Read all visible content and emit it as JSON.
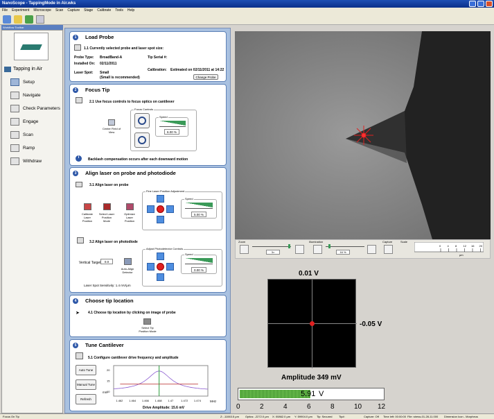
{
  "window": {
    "title": "NanoScope - TappingMode in Air.wks"
  },
  "menu": [
    "File",
    "Experiment",
    "Microscope",
    "Scan",
    "Capture",
    "Stage",
    "Calibrate",
    "Tools",
    "Help"
  ],
  "workflow": {
    "header": "Workflow Toolbar",
    "mode": "Tapping in Air",
    "items": [
      "Setup",
      "Navigate",
      "Check Parameters",
      "Engage",
      "Scan",
      "Ramp",
      "Withdraw"
    ]
  },
  "load_probe": {
    "num": "1",
    "title": "Load Probe",
    "step": "1.1 Currently selected probe and laser spot size:",
    "probe_type_label": "Probe Type:",
    "probe_type": "BroadBand-A",
    "tip_serial_label": "Tip Serial #:",
    "installed_label": "Installed On:",
    "installed": "02/11/2011",
    "calibration_label": "Calibration:",
    "calibration": "Estimated on 02/11/2011 at 14:22",
    "laser_spot_label": "Laser Spot:",
    "laser_spot": "Small",
    "laser_note": "(Small is recommended)",
    "change_button": "Change Probe"
  },
  "focus_tip": {
    "num": "2",
    "title": "Focus Tip",
    "step": "2.1 Use focus controls to focus optics on cantilever",
    "controls_label": "Focus Controls",
    "center_field": "Center Field of View",
    "speed_label": "Speed",
    "speed_value": "6.00 %",
    "backlash": "Backlash compensation occurs after each downward motion"
  },
  "align_laser": {
    "num": "3",
    "title": "Align laser on probe and photodiode",
    "step1": "3.1 Align laser on probe",
    "fine_label": "Fine Laser Position Adjustment",
    "calibrate": "Calibrate Laser Position",
    "select_mode": "Select Laser Position Mode",
    "optimize": "Optimize Laser Position",
    "speed_label": "Speed",
    "speed1": "5.00 %",
    "step2": "3.2 Align laser on photodiode",
    "pd_label": "Adjust Photodetector Controls",
    "vertical_label": "Vertical Target:",
    "vertical_value": "0.0",
    "auto_align": "Auto-Align Detector",
    "speed2": "0.00 %",
    "sensitivity": "Laser Spot Sensitivity: 1.4 mV/μm"
  },
  "tip_location": {
    "num": "4",
    "title": "Choose tip location",
    "step": "4.1 Choose tip location by clicking on image of probe",
    "select_mode": "Select Tip Position Mode"
  },
  "tune": {
    "num": "5",
    "title": "Tune Cantilever",
    "step": "5.1 Configure cantilever drive frequency and amplitude",
    "auto_tune": "Auto Tune",
    "manual_tune": "Manual Tune",
    "refresh": "Refresh",
    "y_unit": "mm",
    "x_unit": "MHz",
    "drive_amp": "Drive Amplitude: 15.6 mV",
    "chart_data": {
      "type": "line",
      "x": [
        1.462,
        1.464,
        1.466,
        1.468,
        1.47,
        1.472,
        1.474
      ],
      "xticks": [
        "1.462",
        "1.464",
        "1.466",
        "1.468",
        "1.47",
        "1.472",
        "1.474"
      ],
      "yticks": [
        "20",
        "15",
        "10"
      ],
      "series": [
        {
          "values": [
            11,
            12.2,
            15,
            19.5,
            15,
            12.2,
            11
          ],
          "color": "#8a5ad0"
        },
        {
          "values": [
            13.5,
            13.5,
            13.5,
            13.5,
            13.5,
            13.5,
            13.5
          ],
          "color": "#c04040"
        }
      ],
      "peak_x": 1.468,
      "xlim": [
        1.461,
        1.4755
      ],
      "ylim": [
        8,
        22
      ]
    }
  },
  "camera_controls": {
    "zoom_label": "Zoom",
    "zoom_value": "3×",
    "illum_label": "Illumination",
    "illum_value": "16 %",
    "capture_label": "Capture",
    "scale_label": "Scale",
    "scale_ticks": [
      "0",
      "4",
      "8",
      "12",
      "16",
      "20"
    ],
    "scale_unit": "μm"
  },
  "detector": {
    "top_value": "0.01 V",
    "side_value": "-0.05 V",
    "amplitude": "Amplitude 349 mV",
    "bar_value": "5.91",
    "bar_unit": "V",
    "bar_fraction": 0.4925,
    "scale": [
      "0",
      "2",
      "4",
      "6",
      "8",
      "10",
      "12"
    ]
  },
  "status": {
    "left": "Focus On Tip",
    "z": "Z: -11063.5 μm",
    "optics": "Optics: -2272.0 μm",
    "x": "X: 00862.0 μm",
    "y": "Y: 59904.0 μm",
    "tip": "Tip: Secured",
    "tip_num": "Tip#:",
    "capture": "Capture: Off",
    "time": "Time left: 00:00:00",
    "file": "File: stress-01-28-11.000",
    "dimension": "Dimension Icon - Morpheus"
  }
}
